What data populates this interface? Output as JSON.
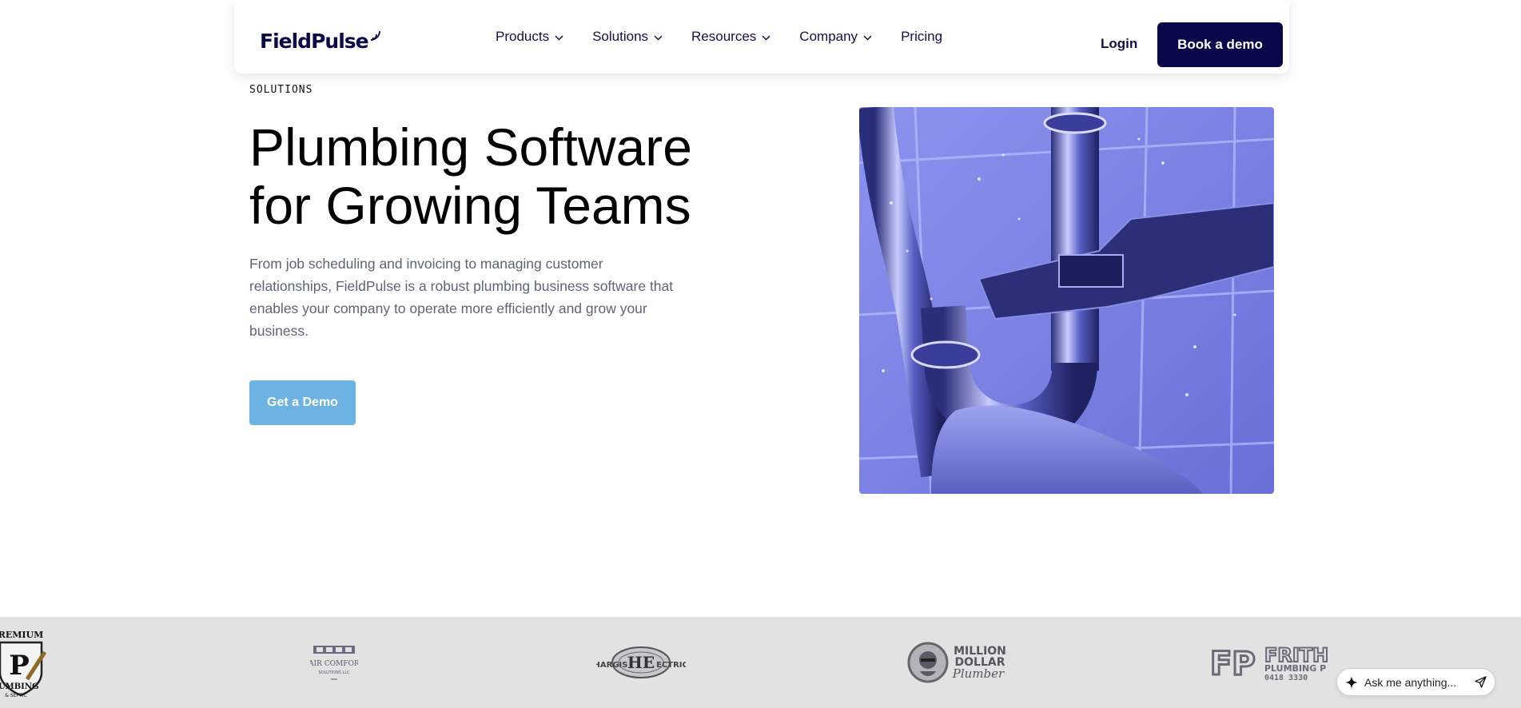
{
  "brand": {
    "name": "FieldPulse"
  },
  "nav": {
    "items": [
      {
        "label": "Products",
        "has_dropdown": true
      },
      {
        "label": "Solutions",
        "has_dropdown": true
      },
      {
        "label": "Resources",
        "has_dropdown": true
      },
      {
        "label": "Company",
        "has_dropdown": true
      },
      {
        "label": "Pricing",
        "has_dropdown": false
      }
    ],
    "login_label": "Login",
    "demo_label": "Book a demo"
  },
  "hero": {
    "eyebrow": "SOLUTIONS",
    "title_line1": "Plumbing Software",
    "title_line2": "for Growing Teams",
    "description": "From job scheduling and invoicing to managing customer relationships, FieldPulse is a robust plumbing business software that enables your company to operate more efficiently and grow your business.",
    "cta_label": "Get a Demo"
  },
  "customer_logos": {
    "premium": {
      "top": "REMIUM",
      "letter": "P",
      "bottom": "LUMBING",
      "sub": "& SEPTIC"
    },
    "fair_comfort": {
      "line1": "FAIR COMFORT",
      "line2": "SOLUTIONS LLC"
    },
    "hargis": {
      "left": "HARGIS",
      "mono": "HE",
      "right": "ECTRIC"
    },
    "million_dollar": {
      "line1": "MILLION",
      "line2": "DOLLAR",
      "line3": "Plumber"
    },
    "frith": {
      "mono": "FP",
      "line1": "FRITH",
      "line2": "PLUMBING P",
      "line3": "0418 3330"
    }
  },
  "chat": {
    "placeholder": "Ask me anything..."
  },
  "colors": {
    "navy": "#07074a",
    "cta_blue": "#6cb3e3",
    "strip_gray": "#e2e2e2",
    "image_tint": "#7a7fe6"
  }
}
